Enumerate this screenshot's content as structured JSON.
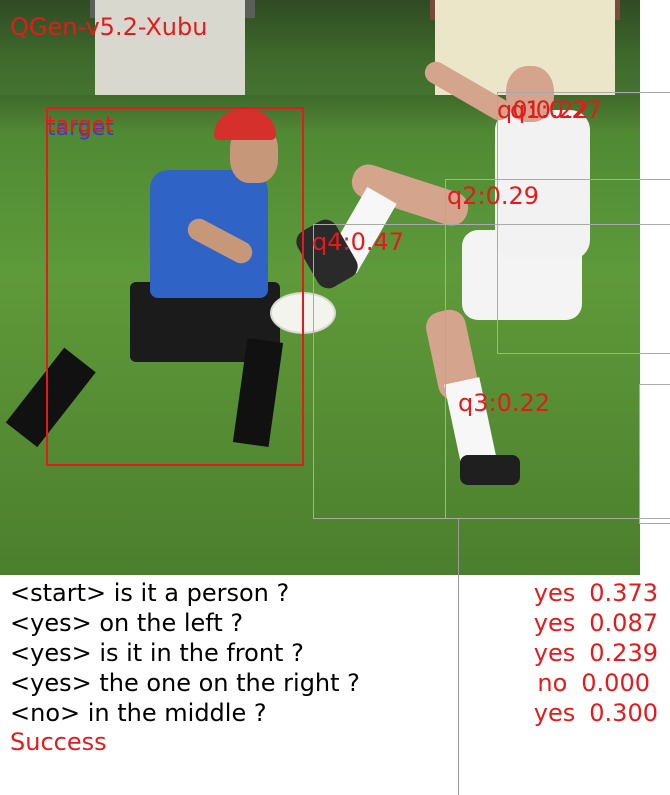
{
  "model_name": "QGen-v5.2-Xubu",
  "target_label": "target",
  "object_labels": {
    "q0": "q0:0.22",
    "q1": "q1:0.27",
    "q2": "q2:0.29",
    "q3": "q3:0.22",
    "q4": "q4:0.47"
  },
  "dialogue": [
    {
      "question": "<start> is it a person ?",
      "answer": "yes",
      "score": "0.373"
    },
    {
      "question": "<yes> on the left ?",
      "answer": "yes",
      "score": "0.087"
    },
    {
      "question": "<yes> is it in the front ?",
      "answer": "yes",
      "score": "0.239"
    },
    {
      "question": "<yes> the one on the right ?",
      "answer": "no",
      "score": "0.000"
    },
    {
      "question": "<no> in the middle ?",
      "answer": "yes",
      "score": "0.300"
    }
  ],
  "result": "Success",
  "colors": {
    "highlight": "#e41a1c",
    "target_blue": "#3a3ad6",
    "candidate_box": "#aaaaaa"
  }
}
